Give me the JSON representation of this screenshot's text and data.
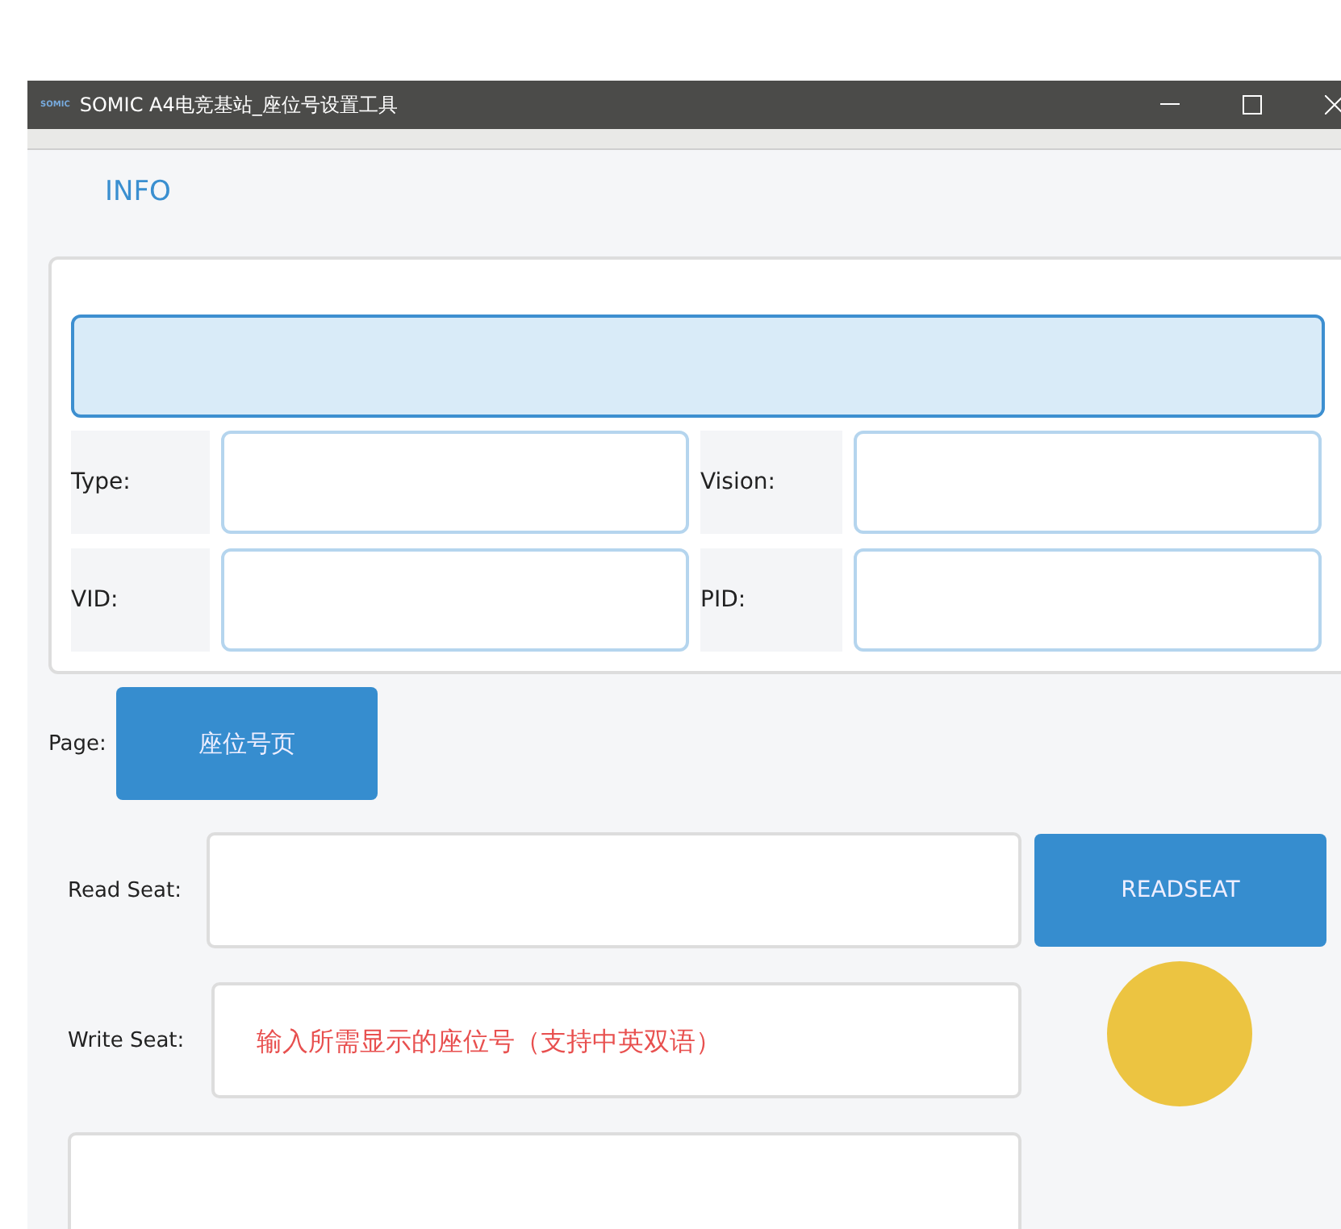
{
  "window": {
    "title": "SOMIC A4电竞基站_座位号设置工具",
    "logo": "SOMIC"
  },
  "section_title": "INFO",
  "info": {
    "fields": [
      {
        "label": "Type:"
      },
      {
        "label": "Vision:"
      },
      {
        "label": "VID:"
      },
      {
        "label": "PID:"
      }
    ]
  },
  "page": {
    "label": "Page:",
    "button": "座位号页"
  },
  "read_seat": {
    "label": "Read Seat:",
    "button": "READSEAT"
  },
  "write_seat": {
    "label": "Write Seat:",
    "placeholder": "输入所需显示的座位号（支持中英双语）"
  }
}
